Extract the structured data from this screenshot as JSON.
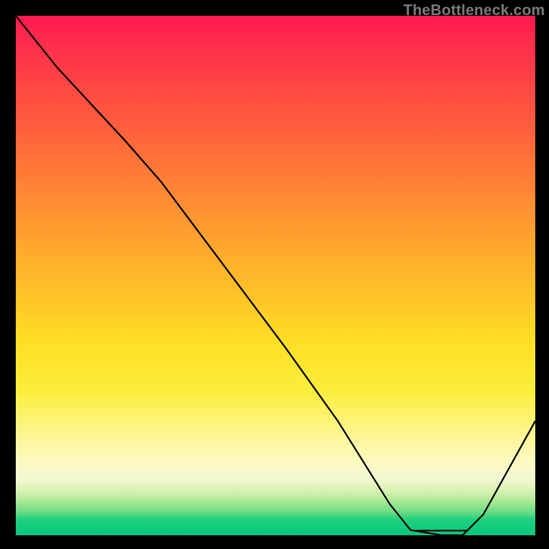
{
  "watermark": "TheBottleneck.com",
  "chart_data": {
    "type": "line",
    "title": "",
    "xlabel": "",
    "ylabel": "",
    "xlim": [
      0,
      100
    ],
    "ylim": [
      0,
      100
    ],
    "grid": false,
    "legend": false,
    "notes": "Qualitative bottleneck curve over a vertical red→green gradient. Y encodes bottleneck severity (top = worst, bottom = optimal). X encodes an unlabeled parameter. Curve values are eyeballed from the image.",
    "series": [
      {
        "name": "bottleneck-curve",
        "x": [
          0,
          8,
          21,
          28,
          40,
          52,
          62,
          72,
          76,
          82,
          86,
          90,
          100
        ],
        "values": [
          100,
          90,
          76,
          68,
          52,
          36,
          22,
          6,
          1,
          0,
          0,
          4,
          22
        ]
      }
    ],
    "optimal_band": {
      "x_start": 77,
      "x_end": 87,
      "y": 0.9
    },
    "gradient_stops": [
      {
        "pct": 0,
        "color": "#ff1a50"
      },
      {
        "pct": 20,
        "color": "#ff5a3e"
      },
      {
        "pct": 50,
        "color": "#ffb829"
      },
      {
        "pct": 72,
        "color": "#fbee3a"
      },
      {
        "pct": 87,
        "color": "#fcfac6"
      },
      {
        "pct": 97,
        "color": "#1fd07e"
      },
      {
        "pct": 100,
        "color": "#07c77d"
      }
    ],
    "marker_color": "#e46a6f"
  }
}
